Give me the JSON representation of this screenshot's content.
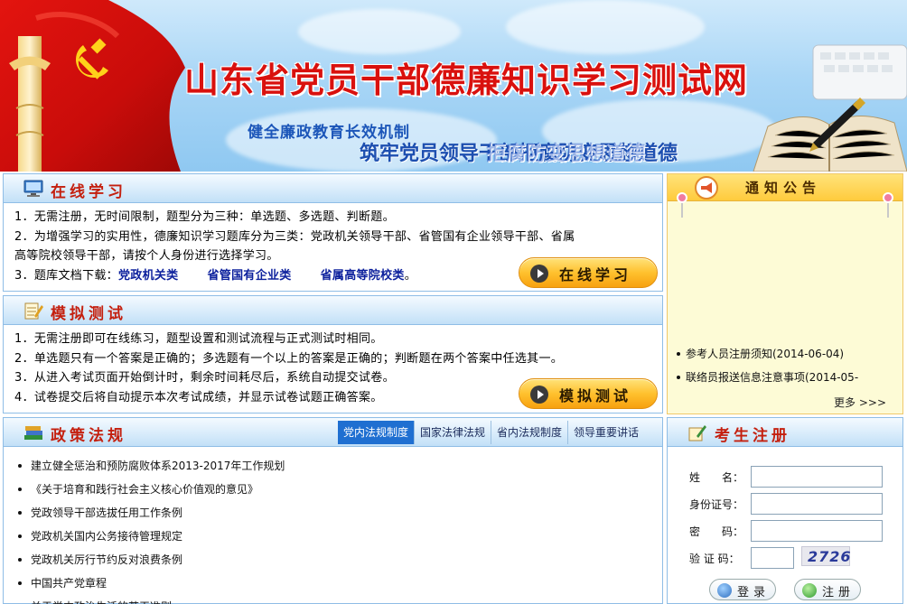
{
  "banner": {
    "title": "山东省党员干部德廉知识学习测试网",
    "slogan1": "健全廉政教育长效机制",
    "slogan2": "筑牢党员领导干部拒腐防变思想道德",
    "slogan2_ghost": "拒腐防变思想道德"
  },
  "online_study": {
    "title": "在线学习",
    "lines": [
      "1．无需注册，无时间限制，题型分为三种：单选题、多选题、判断题。",
      "2．为增强学习的实用性，德廉知识学习题库分为三类：党政机关领导干部、省管国有企业领导干部、省属",
      "高等院校领导干部，请按个人身份进行选择学习。"
    ],
    "download_prefix": "3．题库文档下载：",
    "download_links": [
      "党政机关类",
      "省管国有企业类",
      "省属高等院校类"
    ],
    "download_suffix": "。",
    "button": "在线学习"
  },
  "mock_test": {
    "title": "模拟测试",
    "lines": [
      "1．无需注册即可在线练习，题型设置和测试流程与正式测试时相同。",
      "2．单选题只有一个答案是正确的；多选题有一个以上的答案是正确的；判断题在两个答案中任选其一。",
      "3．从进入考试页面开始倒计时，剩余时间耗尽后，系统自动提交试卷。",
      "4．试卷提交后将自动提示本次考试成绩，并显示试卷试题正确答案。"
    ],
    "button": "模拟测试"
  },
  "policy": {
    "title": "政策法规",
    "tabs": [
      "党内法规制度",
      "国家法律法规",
      "省内法规制度",
      "领导重要讲话"
    ],
    "active_tab": 0,
    "items": [
      "建立健全惩治和预防腐败体系2013-2017年工作规划",
      "《关于培育和践行社会主义核心价值观的意见》",
      "党政领导干部选拔任用工作条例",
      "党政机关国内公务接待管理规定",
      "党政机关厉行节约反对浪费条例",
      "中国共产党章程",
      "关于党内政治生活的若干准则"
    ]
  },
  "notice": {
    "title": "通知公告",
    "items": [
      "参考人员注册须知(2014-06-04)",
      "联络员报送信息注意事项(2014-05-"
    ],
    "more": "更多 >>>"
  },
  "register": {
    "title": "考生注册",
    "name_label": "姓　　名：",
    "id_label": "身份证号：",
    "password_label": "密　　码：",
    "captcha_label": "验 证 码：",
    "captcha_text": "2726",
    "login_button": "登录",
    "register_button": "注册"
  },
  "colors": {
    "title_red": "#d9110e",
    "slogan_blue": "#1c56b9",
    "link_blue": "#0b1f9c",
    "panel_border": "#8fbde6",
    "tab_active": "#1f6fd1",
    "button_orange": "#ffc12e"
  }
}
